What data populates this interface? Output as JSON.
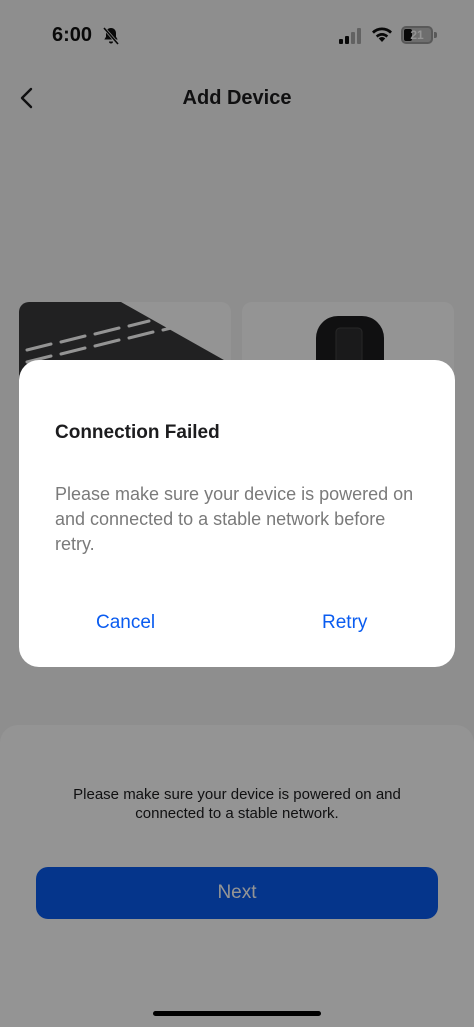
{
  "status_bar": {
    "time": "6:00",
    "battery": "21",
    "icons": [
      "bell-slash-icon",
      "cellular-signal-icon",
      "wifi-icon",
      "battery-icon"
    ]
  },
  "header": {
    "title": "Add Device",
    "back_icon": "chevron-left-icon"
  },
  "device_cards": [
    {
      "image": "vent-device-image"
    },
    {
      "image": "plug-device-image"
    }
  ],
  "bottom": {
    "hint": "Please make sure your device is powered on and connected to a stable network.",
    "next_label": "Next"
  },
  "dialog": {
    "title": "Connection Failed",
    "message": "Please make sure your device is powered on and connected to a stable network before retry.",
    "cancel_label": "Cancel",
    "retry_label": "Retry"
  },
  "colors": {
    "accent": "#0a5cf0",
    "overlay": "rgba(0,0,0,0.42)"
  }
}
